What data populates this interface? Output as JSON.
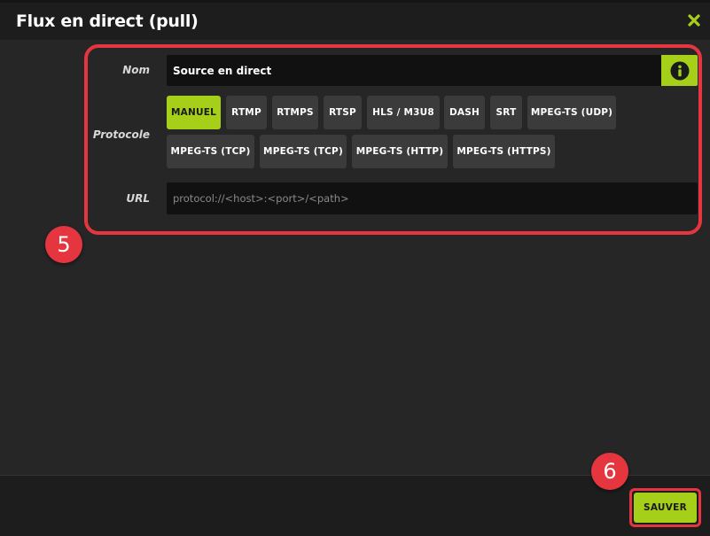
{
  "dialog": {
    "title": "Flux en direct (pull)",
    "close_icon": "close-x-icon",
    "accent": "#a6cf19",
    "highlight": "#e5363f"
  },
  "form": {
    "name_label": "Nom",
    "name_value": "Source en direct",
    "info_icon": "info-icon",
    "protocol_label": "Protocole",
    "protocols": [
      {
        "label": "MANUEL",
        "active": true
      },
      {
        "label": "RTMP",
        "active": false
      },
      {
        "label": "RTMPS",
        "active": false
      },
      {
        "label": "RTSP",
        "active": false
      },
      {
        "label": "HLS / M3U8",
        "active": false
      },
      {
        "label": "DASH",
        "active": false
      },
      {
        "label": "SRT",
        "active": false
      },
      {
        "label": "MPEG-TS (UDP)",
        "active": false
      },
      {
        "label": "MPEG-TS (TCP)",
        "active": false
      },
      {
        "label": "MPEG-TS (TCP)",
        "active": false
      },
      {
        "label": "MPEG-TS (HTTP)",
        "active": false
      },
      {
        "label": "MPEG-TS (HTTPS)",
        "active": false
      }
    ],
    "url_label": "URL",
    "url_value": "",
    "url_placeholder": "protocol://<host>:<port>/<path>"
  },
  "annotations": {
    "step_form": "5",
    "step_save": "6"
  },
  "footer": {
    "save_label": "SAUVER"
  }
}
